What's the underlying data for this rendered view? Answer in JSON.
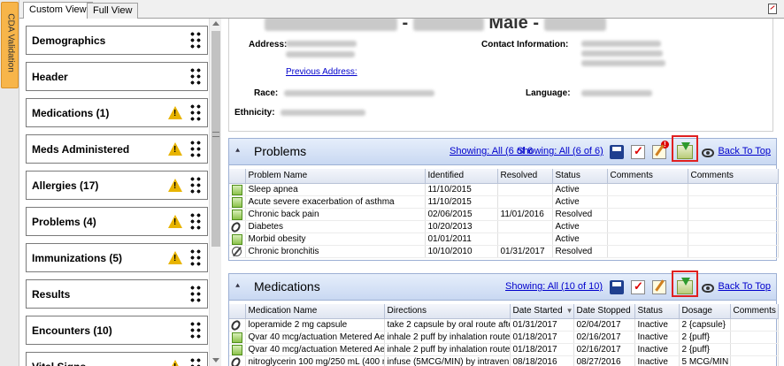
{
  "vertical_tab": {
    "label": "CDA Validation"
  },
  "tabs": [
    {
      "label": "Custom View",
      "active": true
    },
    {
      "label": "Full View",
      "active": false
    }
  ],
  "sections": [
    {
      "label": "Demographics",
      "warning": false
    },
    {
      "label": "Header",
      "warning": false
    },
    {
      "label": "Medications (1)",
      "warning": true
    },
    {
      "label": "Meds Administered",
      "warning": true
    },
    {
      "label": "Allergies (17)",
      "warning": true
    },
    {
      "label": "Problems (4)",
      "warning": true
    },
    {
      "label": "Immunizations (5)",
      "warning": true
    },
    {
      "label": "Results",
      "warning": false
    },
    {
      "label": "Encounters (10)",
      "warning": false
    },
    {
      "label": "Vital Signs",
      "warning": true
    }
  ],
  "patient": {
    "sex": "Male",
    "fields": {
      "address_label": "Address:",
      "previous_address": "Previous Address:",
      "race_label": "Race:",
      "ethnicity_label": "Ethnicity:",
      "contact_label": "Contact Information:",
      "language_label": "Language:"
    }
  },
  "problems": {
    "title": "Problems",
    "showing_1": "Showing: All (6 of 6",
    "showing_2": "Showing: All (6 of 6)",
    "back_to_top": "Back To Top",
    "columns": [
      "Problem Name",
      "Identified",
      "Resolved",
      "Status",
      "Comments",
      "Comments"
    ],
    "rows": [
      {
        "icon": "green",
        "name": "Sleep apnea",
        "identified": "11/10/2015",
        "resolved": "",
        "status": "Active"
      },
      {
        "icon": "green",
        "name": "Acute severe exacerbation of asthma",
        "identified": "11/10/2015",
        "resolved": "",
        "status": "Active"
      },
      {
        "icon": "green",
        "name": "Chronic back pain",
        "identified": "02/06/2015",
        "resolved": "11/01/2016",
        "status": "Resolved"
      },
      {
        "icon": "link",
        "name": "Diabetes",
        "identified": "10/20/2013",
        "resolved": "",
        "status": "Active"
      },
      {
        "icon": "green",
        "name": "Morbid obesity",
        "identified": "01/01/2011",
        "resolved": "",
        "status": "Active"
      },
      {
        "icon": "null",
        "name": "Chronic bronchitis",
        "identified": "10/10/2010",
        "resolved": "01/31/2017",
        "status": "Resolved"
      }
    ]
  },
  "medications": {
    "title": "Medications",
    "showing": "Showing: All (10 of 10)",
    "back_to_top": "Back To Top",
    "columns": [
      "Medication Name",
      "Directions",
      "Date Started",
      "Date Stopped",
      "Status",
      "Dosage",
      "Comments"
    ],
    "rows": [
      {
        "icon": "link",
        "name": "loperamide 2 mg capsule",
        "directions": "take 2 capsule by oral route afte...",
        "started": "01/31/2017",
        "stopped": "02/04/2017",
        "status": "Inactive",
        "dosage": "2 {capsule}"
      },
      {
        "icon": "green",
        "name": "Qvar 40 mcg/actuation Metered Aer...",
        "directions": "inhale 2 puff by inhalation route...",
        "started": "01/18/2017",
        "stopped": "02/16/2017",
        "status": "Inactive",
        "dosage": "2 {puff}"
      },
      {
        "icon": "green",
        "name": "Qvar 40 mcg/actuation Metered Aer...",
        "directions": "inhale 2 puff by inhalation route...",
        "started": "01/18/2017",
        "stopped": "02/16/2017",
        "status": "Inactive",
        "dosage": "2 {puff}"
      },
      {
        "icon": "link",
        "name": "nitroglycerin 100 mg/250 mL (400 m...",
        "directions": "infuse (5MCG/MIN) by intraven...",
        "started": "08/18/2016",
        "stopped": "08/27/2016",
        "status": "Inactive",
        "dosage": "5 MCG/MIN"
      }
    ]
  }
}
